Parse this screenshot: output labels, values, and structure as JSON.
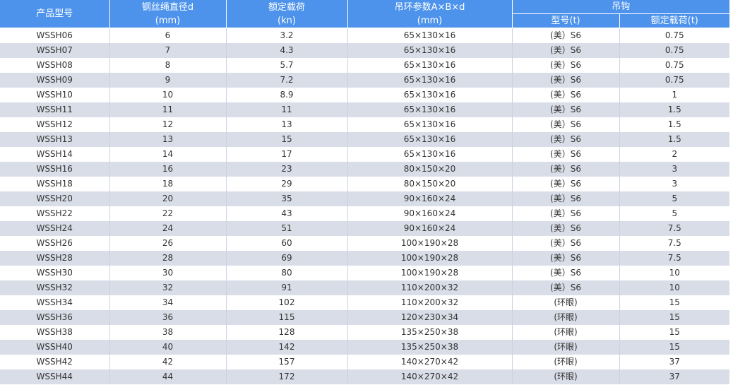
{
  "table": {
    "headers": {
      "model": "产品型号",
      "diameter": {
        "line1": "钢丝绳直径d",
        "line2": "(mm)"
      },
      "load": {
        "line1": "额定载荷",
        "line2": "(kn)"
      },
      "ring": {
        "line1": "吊环参数A×B×d",
        "line2": "(mm)"
      },
      "hook": "吊钩",
      "hook_type": "型号(t)",
      "hook_load": "额定载荷(t)"
    },
    "rows": [
      [
        "WSSH06",
        "6",
        "3.2",
        "65×130×16",
        "(美）S6",
        "0.75"
      ],
      [
        "WSSH07",
        "7",
        "4.3",
        "65×130×16",
        "(美）S6",
        "0.75"
      ],
      [
        "WSSH08",
        "8",
        "5.7",
        "65×130×16",
        "(美）S6",
        "0.75"
      ],
      [
        "WSSH09",
        "9",
        "7.2",
        "65×130×16",
        "(美）S6",
        "0.75"
      ],
      [
        "WSSH10",
        "10",
        "8.9",
        "65×130×16",
        "(美）S6",
        "1"
      ],
      [
        "WSSH11",
        "11",
        "11",
        "65×130×16",
        "(美）S6",
        "1.5"
      ],
      [
        "WSSH12",
        "12",
        "13",
        "65×130×16",
        "(美）S6",
        "1.5"
      ],
      [
        "WSSH13",
        "13",
        "15",
        "65×130×16",
        "(美）S6",
        "1.5"
      ],
      [
        "WSSH14",
        "14",
        "17",
        "65×130×16",
        "(美）S6",
        "2"
      ],
      [
        "WSSH16",
        "16",
        "23",
        "80×150×20",
        "(美）S6",
        "3"
      ],
      [
        "WSSH18",
        "18",
        "29",
        "80×150×20",
        "(美）S6",
        "3"
      ],
      [
        "WSSH20",
        "20",
        "35",
        "90×160×24",
        "(美）S6",
        "5"
      ],
      [
        "WSSH22",
        "22",
        "43",
        "90×160×24",
        "(美）S6",
        "5"
      ],
      [
        "WSSH24",
        "24",
        "51",
        "90×160×24",
        "(美）S6",
        "7.5"
      ],
      [
        "WSSH26",
        "26",
        "60",
        "100×190×28",
        "(美）S6",
        "7.5"
      ],
      [
        "WSSH28",
        "28",
        "69",
        "100×190×28",
        "(美）S6",
        "7.5"
      ],
      [
        "WSSH30",
        "30",
        "80",
        "100×190×28",
        "(美）S6",
        "10"
      ],
      [
        "WSSH32",
        "32",
        "91",
        "110×200×32",
        "(美）S6",
        "10"
      ],
      [
        "WSSH34",
        "34",
        "102",
        "110×200×32",
        "(环眼)",
        "15"
      ],
      [
        "WSSH36",
        "36",
        "115",
        "120×230×34",
        "(环眼)",
        "15"
      ],
      [
        "WSSH38",
        "38",
        "128",
        "135×250×38",
        "(环眼)",
        "15"
      ],
      [
        "WSSH40",
        "40",
        "142",
        "135×250×38",
        "(环眼)",
        "15"
      ],
      [
        "WSSH42",
        "42",
        "157",
        "140×270×42",
        "(环眼)",
        "37"
      ],
      [
        "WSSH44",
        "44",
        "172",
        "140×270×42",
        "(环眼)",
        "37"
      ]
    ]
  }
}
